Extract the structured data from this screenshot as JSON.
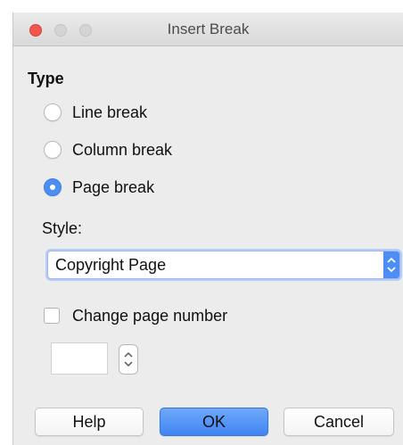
{
  "window": {
    "title": "Insert Break",
    "controls": [
      "close",
      "minimize",
      "zoom"
    ]
  },
  "type_section": {
    "heading": "Type",
    "options": [
      {
        "label": "Line break",
        "selected": false
      },
      {
        "label": "Column break",
        "selected": false
      },
      {
        "label": "Page break",
        "selected": true
      }
    ]
  },
  "style": {
    "label": "Style:",
    "selected_value": "Copyright Page"
  },
  "page_number": {
    "checkbox_label": "Change page number",
    "checked": false,
    "value": ""
  },
  "buttons": {
    "help": "Help",
    "ok": "OK",
    "cancel": "Cancel"
  },
  "colors": {
    "accent": "#4d8ef5",
    "close": "#f2564f"
  }
}
